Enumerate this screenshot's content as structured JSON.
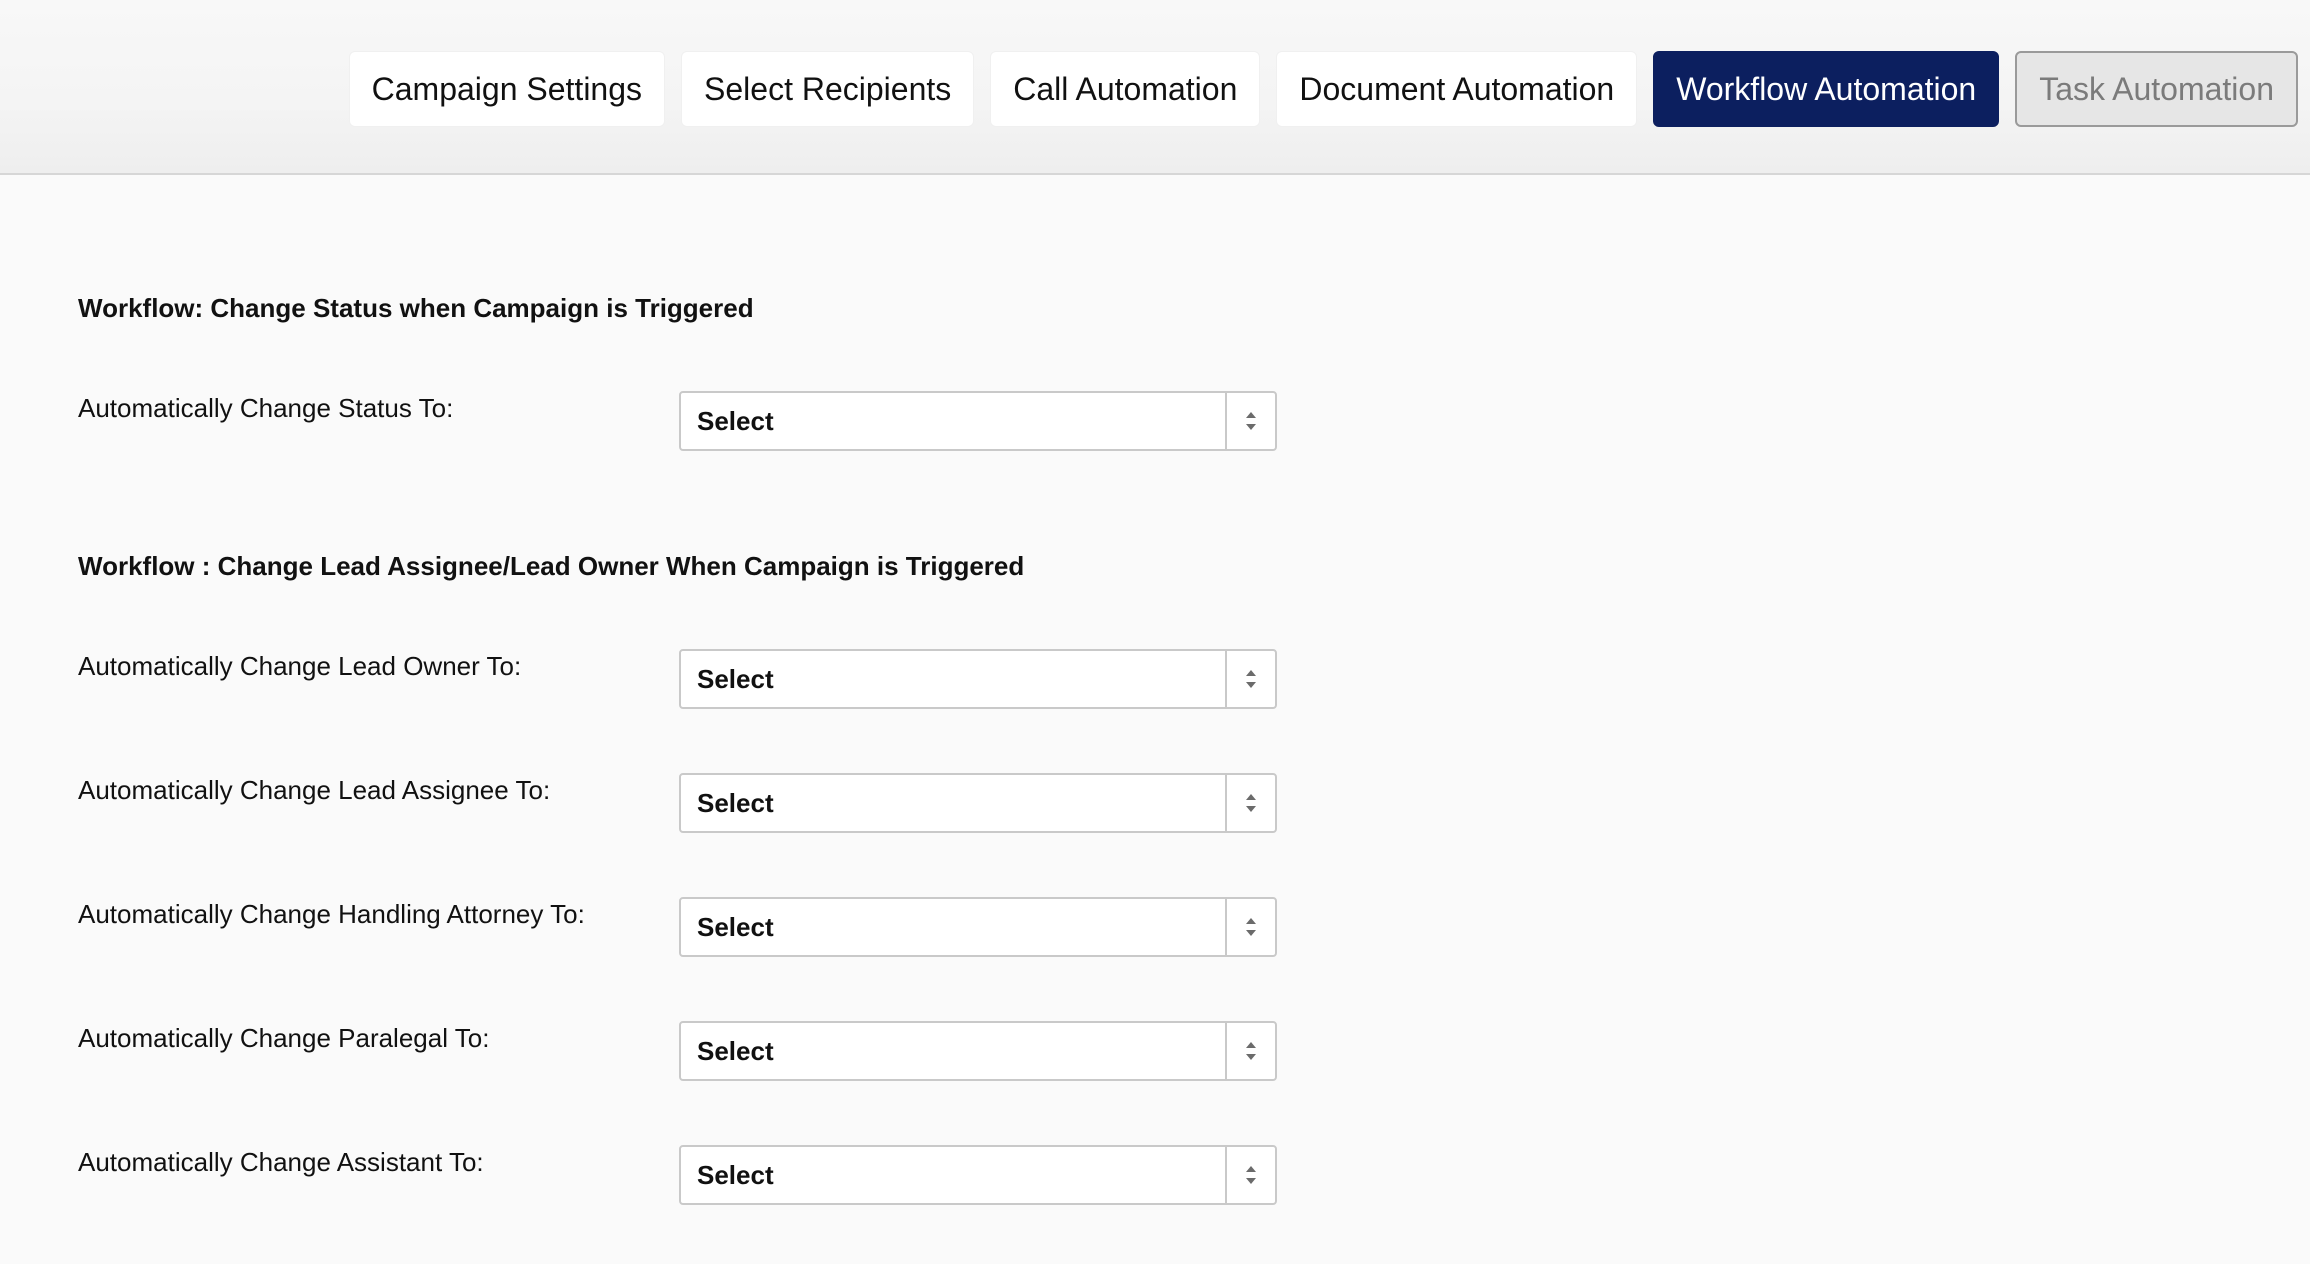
{
  "tabs": [
    {
      "label": "Campaign Settings",
      "state": "normal"
    },
    {
      "label": "Select Recipients",
      "state": "normal"
    },
    {
      "label": "Call Automation",
      "state": "normal"
    },
    {
      "label": "Document Automation",
      "state": "normal"
    },
    {
      "label": "Workflow Automation",
      "state": "active"
    },
    {
      "label": "Task Automation",
      "state": "disabled"
    }
  ],
  "sections": [
    {
      "title": "Workflow: Change Status when Campaign is Triggered",
      "fields": [
        {
          "label": "Automatically Change Status To:",
          "value": "Select"
        }
      ]
    },
    {
      "title": "Workflow : Change Lead Assignee/Lead Owner When Campaign is Triggered",
      "fields": [
        {
          "label": "Automatically Change Lead Owner To:",
          "value": "Select"
        },
        {
          "label": "Automatically Change Lead Assignee To:",
          "value": "Select"
        },
        {
          "label": "Automatically Change Handling Attorney To:",
          "value": "Select"
        },
        {
          "label": "Automatically Change Paralegal To:",
          "value": "Select"
        },
        {
          "label": "Automatically Change Assistant To:",
          "value": "Select"
        }
      ]
    }
  ],
  "colors": {
    "active_tab": "#0c1f5f",
    "disabled_tab": "#e6e6e6"
  },
  "icons": {
    "select_arrows": "up-down-arrows-icon"
  }
}
